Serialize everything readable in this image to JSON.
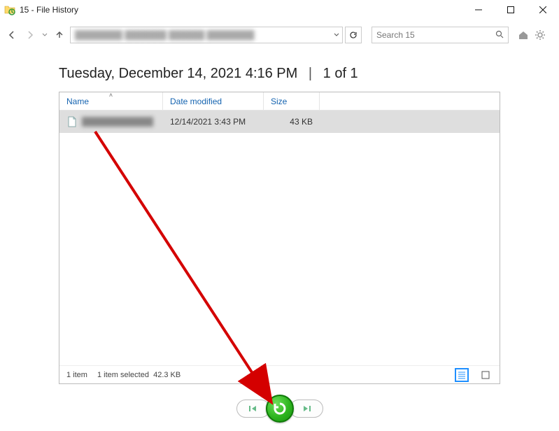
{
  "window": {
    "title": "15 - File History"
  },
  "toolbar": {
    "search_placeholder": "Search 15"
  },
  "heading": {
    "timestamp": "Tuesday, December 14, 2021 4:16 PM",
    "page_indicator": "1 of 1"
  },
  "columns": {
    "name": "Name",
    "date": "Date modified",
    "size": "Size"
  },
  "rows": [
    {
      "name": "████████████",
      "date": "12/14/2021 3:43 PM",
      "size": "43 KB",
      "selected": true
    }
  ],
  "status": {
    "count": "1 item",
    "selection": "1 item selected",
    "sel_size": "42.3 KB"
  }
}
